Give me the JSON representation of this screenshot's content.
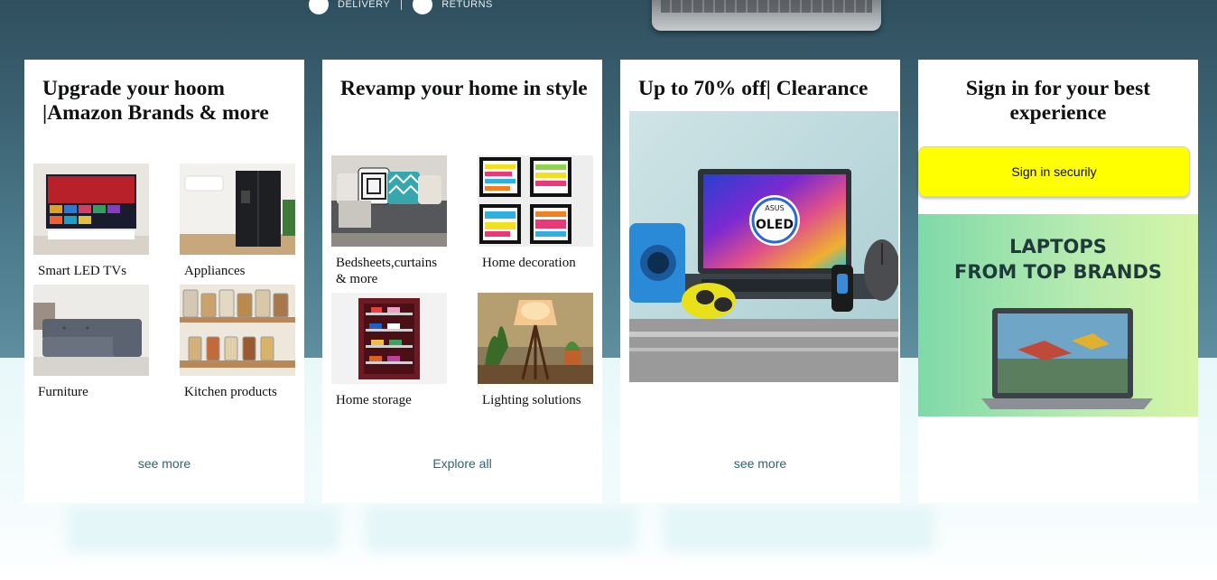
{
  "hero": {
    "delivery_text": "DELIVERY",
    "returns_text": "RETURNS"
  },
  "cards": [
    {
      "title": "Upgrade your hoom |Amazon Brands & more",
      "tiles": [
        {
          "label": "Smart LED TVs",
          "icon": "tv-image"
        },
        {
          "label": "Appliances",
          "icon": "refrigerator-image"
        },
        {
          "label": "Furniture",
          "icon": "sofa-image"
        },
        {
          "label": "Kitchen products",
          "icon": "jars-image"
        }
      ],
      "link": "see more"
    },
    {
      "title": "Revamp your home in style",
      "tiles": [
        {
          "label": "Bedsheets,curtains & more",
          "icon": "cushions-image"
        },
        {
          "label": "Home decoration",
          "icon": "wall-frames-image"
        },
        {
          "label": "Home storage",
          "icon": "shoe-rack-image"
        },
        {
          "label": "Lighting solutions",
          "icon": "lamp-image"
        }
      ],
      "link": "Explore all"
    },
    {
      "title": "Up to 70% off| Clearance",
      "image_text": {
        "brand": "ASUS",
        "badge": "OLED"
      },
      "link": "see more"
    },
    {
      "title": "Sign in for your best experience",
      "button": "Sign in securily",
      "promo": {
        "line1": "LAPTOPS",
        "line2": "FROM TOP BRANDS"
      }
    }
  ],
  "colors": {
    "link": "#2b6475",
    "signin_button": "#ffff00",
    "hero_bg": "#3d6474"
  }
}
